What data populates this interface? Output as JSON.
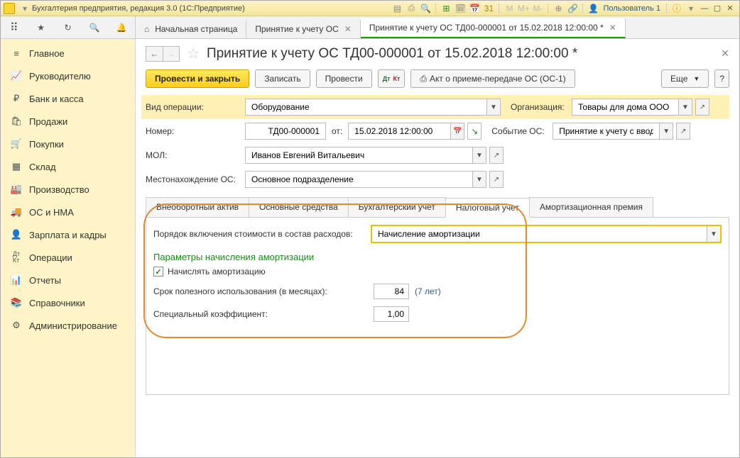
{
  "titlebar": {
    "app_title": "Бухгалтерия предприятия, редакция 3.0  (1С:Предприятие)",
    "user_label": "Пользователь 1"
  },
  "top_tabs": [
    {
      "label": "Начальная страница",
      "closable": false
    },
    {
      "label": "Принятие к учету ОС",
      "closable": true
    },
    {
      "label": "Принятие к учету ОС ТД00-000001 от 15.02.2018 12:00:00 *",
      "closable": true,
      "active": true
    }
  ],
  "sidebar": [
    "Главное",
    "Руководителю",
    "Банк и касса",
    "Продажи",
    "Покупки",
    "Склад",
    "Производство",
    "ОС и НМА",
    "Зарплата и кадры",
    "Операции",
    "Отчеты",
    "Справочники",
    "Администрирование"
  ],
  "doc": {
    "title": "Принятие к учету ОС ТД00-000001 от 15.02.2018 12:00:00 *"
  },
  "actions": {
    "post_close": "Провести и закрыть",
    "write": "Записать",
    "post": "Провести",
    "print": "Акт о приеме-передаче ОС (ОС-1)",
    "more": "Еще",
    "help": "?"
  },
  "fields": {
    "op_type_label": "Вид операции:",
    "op_type_value": "Оборудование",
    "org_label": "Организация:",
    "org_value": "Товары для дома ООО",
    "num_label": "Номер:",
    "num_value": "ТД00-000001",
    "from_label": "от:",
    "date_value": "15.02.2018 12:00:00",
    "event_label": "Событие ОС:",
    "event_value": "Принятие к учету с вводом",
    "mol_label": "МОЛ:",
    "mol_value": "Иванов Евгений Витальевич",
    "loc_label": "Местонахождение ОС:",
    "loc_value": "Основное подразделение"
  },
  "tabs": [
    "Внеоборотный актив",
    "Основные средства",
    "Бухгалтерский учет",
    "Налоговый учет",
    "Амортизационная премия"
  ],
  "tax_tab": {
    "cost_order_label": "Порядок включения стоимости в состав расходов:",
    "cost_order_value": "Начисление амортизации",
    "group_title": "Параметры начисления амортизации",
    "chk_label": "Начислять амортизацию",
    "useful_life_label": "Срок полезного использования (в месяцах):",
    "useful_life_value": "84",
    "useful_life_hint": "(7 лет)",
    "coef_label": "Специальный коэффициент:",
    "coef_value": "1,00"
  }
}
